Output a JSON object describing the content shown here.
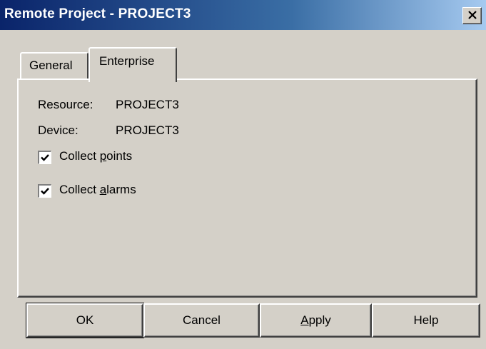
{
  "window": {
    "title": "Remote Project - PROJECT3"
  },
  "tabs": [
    {
      "label": "General"
    },
    {
      "label": "Enterprise"
    }
  ],
  "enterprise": {
    "resource_label": "Resource:",
    "resource_value": "PROJECT3",
    "device_label": "Device:",
    "device_value": "PROJECT3",
    "collect_points": {
      "pre": "Collect ",
      "accel": "p",
      "post": "oints",
      "checked": true
    },
    "collect_alarms": {
      "pre": "Collect ",
      "accel": "a",
      "post": "larms",
      "checked": true
    }
  },
  "buttons": {
    "ok": "OK",
    "cancel": "Cancel",
    "apply": {
      "accel": "A",
      "post": "pply"
    },
    "help": "Help"
  },
  "colors": {
    "face": "#d4d0c8",
    "title_start": "#0a246a",
    "title_end": "#a6caf0"
  }
}
